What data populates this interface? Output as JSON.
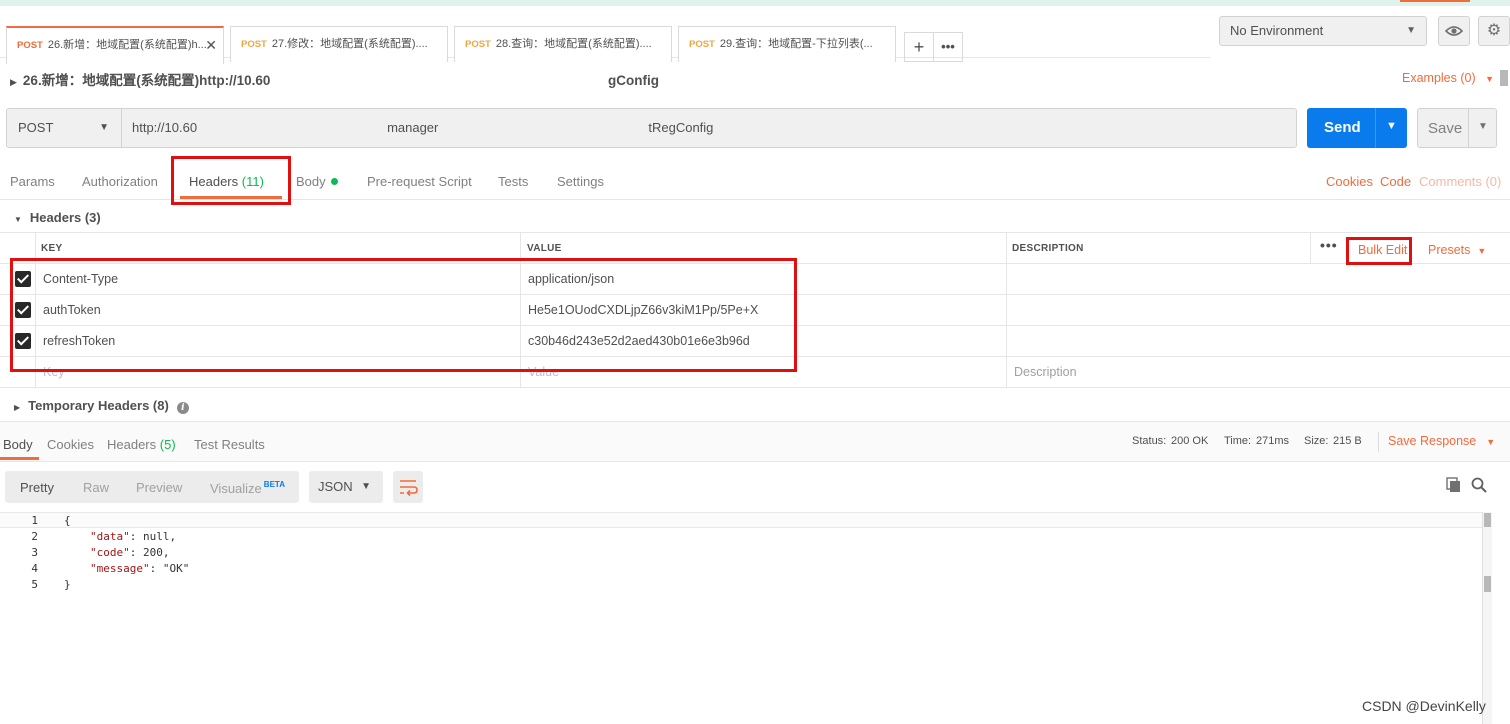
{
  "tabs": [
    {
      "method": "POST",
      "title": "26.新增：地域配置(系统配置)h..."
    },
    {
      "method": "POST",
      "title": "27.修改：地域配置(系统配置)...."
    },
    {
      "method": "POST",
      "title": "28.查询：地域配置(系统配置)...."
    },
    {
      "method": "POST",
      "title": "29.查询：地域配置-下拉列表(..."
    }
  ],
  "environment": {
    "selected": "No Environment"
  },
  "request": {
    "breadcrumb": "26.新增：地域配置(系统配置)http://10.60",
    "breadcrumb_tail": "gConfig",
    "examples_label": "Examples (0)",
    "method": "POST",
    "url_prefix": "http://10.60",
    "url_mid": "manager",
    "url_tail": "tRegConfig",
    "send_label": "Send",
    "save_label": "Save"
  },
  "request_tabs": {
    "params": "Params",
    "authorization": "Authorization",
    "headers": "Headers",
    "headers_count": "(11)",
    "body": "Body",
    "prerequest": "Pre-request Script",
    "tests": "Tests",
    "settings": "Settings",
    "cookies": "Cookies",
    "code": "Code",
    "comments": "Comments (0)"
  },
  "headers_section": {
    "title": "Headers (3)",
    "columns": {
      "key": "KEY",
      "value": "VALUE",
      "description": "DESCRIPTION"
    },
    "bulk_edit": "Bulk Edit",
    "presets": "Presets",
    "rows": [
      {
        "key": "Content-Type",
        "value": "application/json",
        "checked": true
      },
      {
        "key": "authToken",
        "value": "He5e1OUodCXDLjpZ66v3kiM1Pp/5Pe+X",
        "checked": true
      },
      {
        "key": "refreshToken",
        "value": "c30b46d243e52d2aed430b01e6e3b96d",
        "checked": true
      }
    ],
    "placeholders": {
      "key": "Key",
      "value": "Value",
      "description": "Description"
    },
    "temporary": "Temporary Headers (8)"
  },
  "response": {
    "tabs": {
      "body": "Body",
      "cookies": "Cookies",
      "headers": "Headers",
      "headers_count": "(5)",
      "tests": "Test Results"
    },
    "status_label": "Status:",
    "status_value": "200 OK",
    "time_label": "Time:",
    "time_value": "271ms",
    "size_label": "Size:",
    "size_value": "215 B",
    "save_response": "Save Response",
    "view_modes": {
      "pretty": "Pretty",
      "raw": "Raw",
      "preview": "Preview",
      "visualize": "Visualize",
      "beta": "BETA"
    },
    "format": "JSON",
    "code_lines": [
      {
        "n": "1",
        "text": "{"
      },
      {
        "n": "2",
        "key": "\"data\"",
        "rest": ": null,"
      },
      {
        "n": "3",
        "key": "\"code\"",
        "rest": ": 200,"
      },
      {
        "n": "4",
        "key": "\"message\"",
        "rest": ": \"OK\""
      },
      {
        "n": "5",
        "text": "}"
      }
    ]
  },
  "watermark": "CSDN @DevinKelly"
}
